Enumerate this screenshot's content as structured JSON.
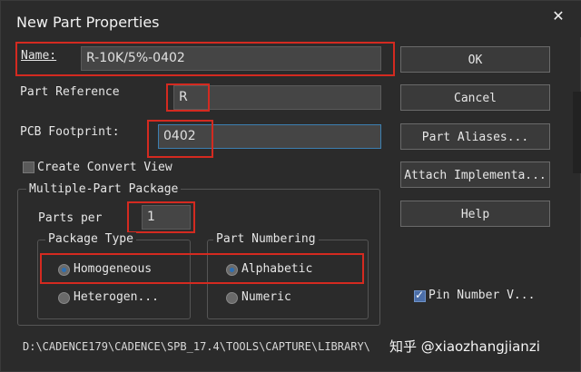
{
  "window": {
    "title": "New Part Properties",
    "close_label": "✕"
  },
  "fields": {
    "name_label": "Name:",
    "name_value": "R-10K/5%-0402",
    "part_reference_label": "Part Reference",
    "part_reference_value": "R",
    "pcb_footprint_label": "PCB Footprint:",
    "pcb_footprint_value": "0402",
    "create_convert_view_label": "Create Convert View"
  },
  "multi_part": {
    "group_title": "Multiple-Part Package",
    "parts_per_label": "Parts per",
    "parts_per_value": "1",
    "package_type": {
      "title": "Package Type",
      "options": [
        "Homogeneous",
        "Heterogen..."
      ],
      "selected": 0
    },
    "part_numbering": {
      "title": "Part Numbering",
      "options": [
        "Alphabetic",
        "Numeric"
      ],
      "selected": 0
    }
  },
  "buttons": {
    "ok": "OK",
    "cancel": "Cancel",
    "part_aliases": "Part Aliases...",
    "attach_implementation": "Attach Implementa...",
    "help": "Help"
  },
  "pin_number_visible_label": "Pin Number V...",
  "status_path": "D:\\CADENCE179\\CADENCE\\SPB_17.4\\TOOLS\\CAPTURE\\LIBRARY\\",
  "watermark": "知乎 @xiaozhangjianzi",
  "accent_colors": {
    "highlight_red": "#d42a20",
    "focus_blue": "#3c7fb1"
  }
}
